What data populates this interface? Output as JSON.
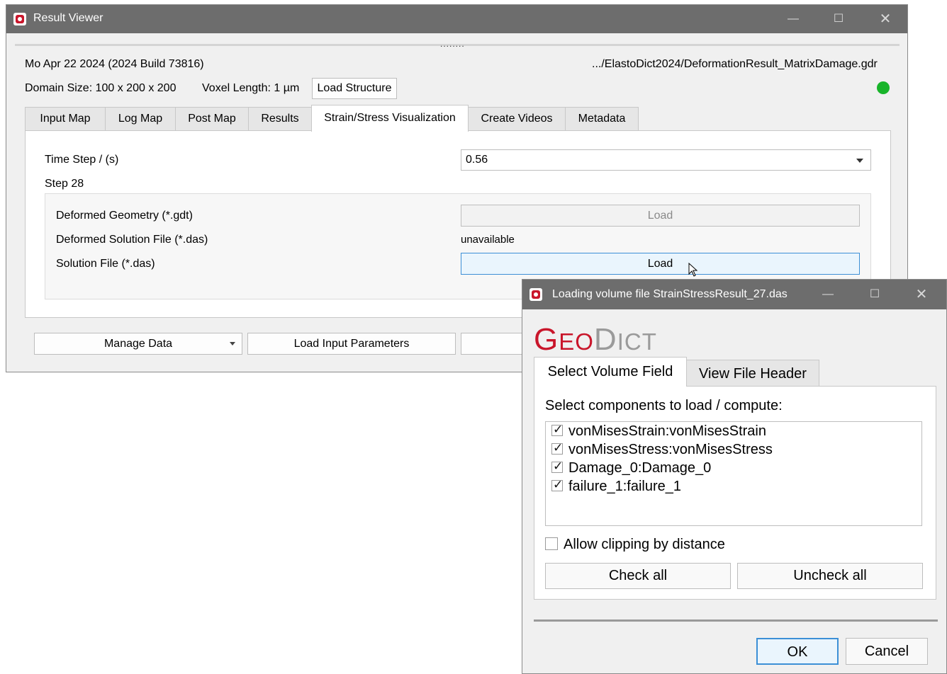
{
  "main_window": {
    "title": "Result Viewer",
    "date_build": "Mo Apr 22 2024 (2024 Build 73816)",
    "file_path": ".../ElastoDict2024/DeformationResult_MatrixDamage.gdr",
    "domain_size": "Domain Size: 100 x 200 x 200",
    "voxel_length": "Voxel Length: 1 µm",
    "load_structure_label": "Load Structure",
    "status_color": "#18b42a",
    "tabs": [
      "Input Map",
      "Log Map",
      "Post Map",
      "Results",
      "Strain/Stress Visualization",
      "Create Videos",
      "Metadata"
    ],
    "active_tab": "Strain/Stress Visualization",
    "time_step_label": "Time Step / (s)",
    "time_step_value": "0.56",
    "step_label": "Step 28",
    "deformed_geometry_label": "Deformed Geometry (*.gdt)",
    "deformed_geometry_button": "Load",
    "deformed_solution_label": "Deformed Solution File (*.das)",
    "deformed_solution_status": "unavailable",
    "solution_file_label": "Solution File (*.das)",
    "solution_file_button": "Load",
    "manage_data_label": "Manage Data",
    "load_input_params_label": "Load Input Parameters"
  },
  "dialog": {
    "title": "Loading volume file StrainStressResult_27.das",
    "logo_text": "GEODICT",
    "tabs": [
      "Select Volume Field",
      "View File Header"
    ],
    "active_tab": "Select Volume Field",
    "components_label": "Select components to load / compute:",
    "components": [
      {
        "label": "vonMisesStrain:vonMisesStrain",
        "checked": true
      },
      {
        "label": "vonMisesStress:vonMisesStress",
        "checked": true
      },
      {
        "label": "Damage_0:Damage_0",
        "checked": true
      },
      {
        "label": "failure_1:failure_1",
        "checked": true
      }
    ],
    "allow_clipping_label": "Allow clipping by distance",
    "allow_clipping_checked": false,
    "check_all_label": "Check all",
    "uncheck_all_label": "Uncheck all",
    "ok_label": "OK",
    "cancel_label": "Cancel"
  }
}
